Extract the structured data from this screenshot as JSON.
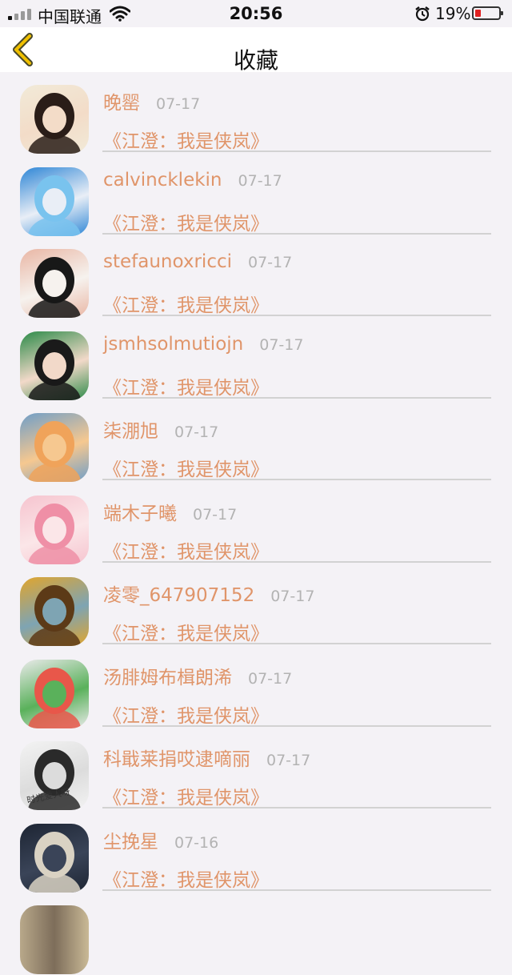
{
  "status_bar": {
    "carrier": "中国联通",
    "time": "20:56",
    "battery": "19%"
  },
  "nav": {
    "title": "收藏",
    "back_icon": "chevron-left-icon",
    "accent": "#f0c000"
  },
  "colors": {
    "name": "#e0956a",
    "date": "#b3b3b3",
    "divider": "#d2d2d2"
  },
  "favorites": [
    {
      "name": "晚罂",
      "date": "07-17",
      "work": "《江澄：我是侠岚》",
      "avatar": [
        "#f1ead8",
        "#2a1d18",
        "#f3dcc8"
      ]
    },
    {
      "name": "calvincklekin",
      "date": "07-17",
      "work": "《江澄：我是侠岚》",
      "avatar": [
        "#2e86d6",
        "#79c3ee",
        "#e9eef6"
      ]
    },
    {
      "name": "stefaunoxricci",
      "date": "07-17",
      "work": "《江澄：我是侠岚》",
      "avatar": [
        "#e9b6a4",
        "#181818",
        "#f6f2ee"
      ]
    },
    {
      "name": "jsmhsolmutiojn",
      "date": "07-17",
      "work": "《江澄：我是侠岚》",
      "avatar": [
        "#2b8a48",
        "#1a1a1a",
        "#f2d9c9"
      ]
    },
    {
      "name": "柒淜旭",
      "date": "07-17",
      "work": "《江澄：我是侠岚》",
      "avatar": [
        "#6f9ec8",
        "#f0a35a",
        "#f6c890"
      ]
    },
    {
      "name": "端木子曦",
      "date": "07-17",
      "work": "《江澄：我是侠岚》",
      "avatar": [
        "#f6c4cf",
        "#ef8fa6",
        "#fbe6e8"
      ]
    },
    {
      "name": "凌零_647907152",
      "date": "07-17",
      "work": "《江澄：我是侠岚》",
      "avatar": [
        "#e1a52d",
        "#5c3a17",
        "#7ea4b3"
      ]
    },
    {
      "name": "汤腓姆布楫朗浠",
      "date": "07-17",
      "work": "《江澄：我是侠岚》",
      "avatar": [
        "#eaeaea",
        "#e8574a",
        "#5ab15b"
      ]
    },
    {
      "name": "科戢莱捐哎逮嘀丽",
      "date": "07-17",
      "work": "《江澄：我是侠岚》",
      "avatar": [
        "#f3f3f3",
        "#2a2a2a",
        "#dcdcdc"
      ]
    },
    {
      "name": "尘挽星",
      "date": "07-16",
      "work": "《江澄：我是侠岚》",
      "avatar": [
        "#1d2533",
        "#d9d2c3",
        "#3a4458"
      ]
    }
  ],
  "avatar_caption": "时光爱人呀"
}
